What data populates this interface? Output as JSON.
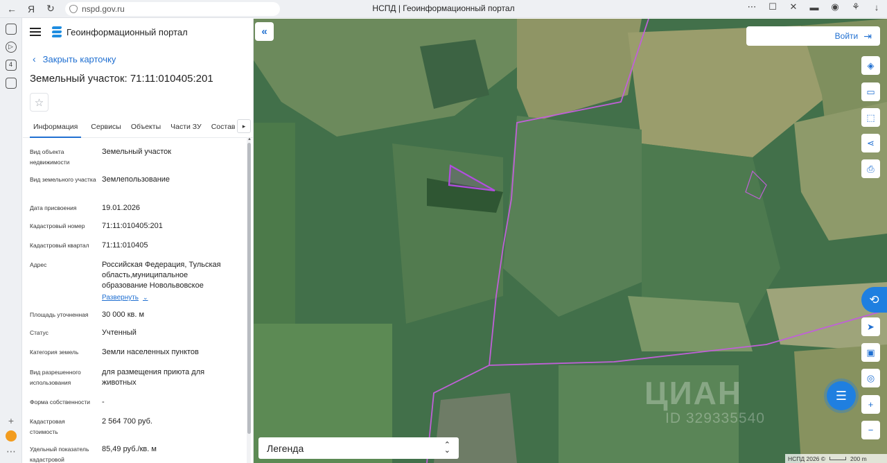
{
  "browser": {
    "url": "nspd.gov.ru",
    "tab_title": "НСПД | Геоинформационный портал",
    "left_strip_badge": "4"
  },
  "panel": {
    "brand": "Геоинформационный портал",
    "close_card": "Закрыть карточку",
    "title": "Земельный участок: 71:11:010405:201",
    "tabs": [
      "Информация",
      "Сервисы",
      "Объекты",
      "Части ЗУ",
      "Состав"
    ],
    "expand_label": "Развернуть",
    "rows": [
      {
        "label": "Вид объекта недвижимости",
        "value": "Земельный участок"
      },
      {
        "label": "Вид земельного участка",
        "value": "Землепользование"
      },
      {
        "label": "Дата присвоения",
        "value": "19.01.2026"
      },
      {
        "label": "Кадастровый номер",
        "value": "71:11:010405:201"
      },
      {
        "label": "Кадастровый квартал",
        "value": "71:11:010405"
      },
      {
        "label": "Адрес",
        "value": "Российская Федерация, Тульская область,муниципальное образование Новольвовское"
      },
      {
        "label": "Площадь уточненная",
        "value": "30 000 кв. м"
      },
      {
        "label": "Статус",
        "value": "Учтенный"
      },
      {
        "label": "Категория земель",
        "value": "Земли населенных пунктов"
      },
      {
        "label": "Вид разрешенного использования",
        "value": "для размещения приюта для животных"
      },
      {
        "label": "Форма собственности",
        "value": "-"
      },
      {
        "label": "Кадастровая стоимость",
        "value": "2 564 700 руб."
      },
      {
        "label": "Удельный показатель кадастровой",
        "value": "85,49 руб./кв. м"
      }
    ]
  },
  "map": {
    "login": "Войти",
    "legend": "Легенда",
    "attribution": "НСПД 2026 ©",
    "scale": "200 m",
    "watermark": "ЦИАН",
    "watermark_id": "ID 329335540",
    "parcel_color": "#b24de0",
    "boundary_color": "#c060d8"
  }
}
